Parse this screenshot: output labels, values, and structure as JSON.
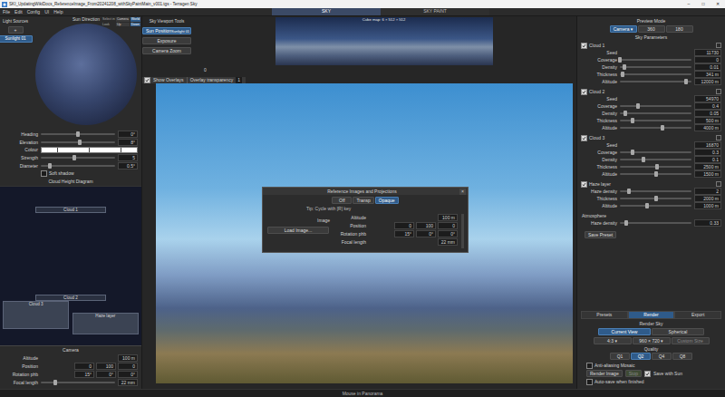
{
  "window": {
    "title": "SKI_UpdatingWikiDocs_ReferenceImage_From20241208_withSkyPaintMain_v001.tgs - Terragen Sky",
    "controls": [
      "–",
      "□",
      "✕"
    ]
  },
  "menu": [
    "File",
    "Edit",
    "Config",
    "UI",
    "Help"
  ],
  "mode_tabs": [
    {
      "label": "SKY",
      "selected": true
    },
    {
      "label": "SKY PAINT",
      "selected": false
    }
  ],
  "light_sources": {
    "title": "Light Sources",
    "add": "+",
    "items": [
      {
        "label": "Sunlight 01",
        "selected": true
      }
    ]
  },
  "sun_direction": {
    "title": "Sun Direction",
    "select_in": {
      "label": "Select in",
      "options": [
        {
          "label": "Camera",
          "selected": false
        },
        {
          "label": "World",
          "selected": true
        }
      ]
    },
    "look": {
      "label": "Look",
      "options": [
        {
          "label": "Up",
          "selected": false
        },
        {
          "label": "Down",
          "selected": true
        }
      ]
    }
  },
  "sun_params": [
    {
      "kind": "slider",
      "label": "Heading",
      "value": "0°",
      "level": 0.5
    },
    {
      "kind": "slider",
      "label": "Elevation",
      "value": "8°",
      "level": 0.52
    },
    {
      "kind": "colour",
      "label": "Colour",
      "swatch": "#ffffff"
    },
    {
      "kind": "slider",
      "label": "Strength",
      "value": "5",
      "level": 0.45
    },
    {
      "kind": "slider",
      "label": "Diameter",
      "value": "0.5°",
      "level": 0.12
    },
    {
      "kind": "check",
      "label": "Soft shadow",
      "checked": false
    }
  ],
  "cloud_diagram": {
    "title": "Cloud Height Diagram",
    "max_m": 14000,
    "layers": [
      {
        "label": "Cloud 1",
        "from_m": 12000,
        "to_m": 12341,
        "lane": "center"
      },
      {
        "label": "Cloud 2",
        "from_m": 4000,
        "to_m": 4500,
        "lane": "center"
      },
      {
        "label": "Cloud 3",
        "from_m": 1500,
        "to_m": 4000,
        "lane": "left"
      },
      {
        "label": "Haze layer",
        "from_m": 1000,
        "to_m": 3000,
        "lane": "right"
      }
    ]
  },
  "camera": {
    "title": "Camera",
    "rows": [
      {
        "kind": "field",
        "label": "Altitude",
        "values": [
          "100 m"
        ]
      },
      {
        "kind": "field",
        "label": "Position",
        "values": [
          "0",
          "100",
          "0"
        ]
      },
      {
        "kind": "field",
        "label": "Rotation phb",
        "values": [
          "15°",
          "0°",
          "0°"
        ]
      },
      {
        "kind": "slider",
        "label": "Focal length",
        "value": "22 mm",
        "level": 0.2
      }
    ]
  },
  "viewport_tools": {
    "title": "Sky Viewport Tools",
    "items": [
      {
        "label": "Sun Position",
        "sub": "Sunlight 01",
        "selected": true
      },
      {
        "label": "Exposure",
        "selected": false
      },
      {
        "label": "Camera Zoom",
        "selected": false
      }
    ]
  },
  "sky_strip": {
    "caption": "Cube map: 6 × 512 × 512",
    "marker": "0"
  },
  "overlays": {
    "checked": true,
    "label": "Show Overlays",
    "transparency_label": "Overlay transparency",
    "transparency": "1"
  },
  "reference_dialog": {
    "title": "Reference Images and Projections",
    "close": "×",
    "display": [
      {
        "label": "Off",
        "selected": false
      },
      {
        "label": "Transp",
        "selected": false
      },
      {
        "label": "Opaque",
        "selected": true
      }
    ],
    "tip": "Tip: Cycle with [R] key",
    "image_label": "Image",
    "load_button": "Load Image...",
    "rows": [
      {
        "kind": "field",
        "label": "Altitude",
        "values": [
          "100 m"
        ]
      },
      {
        "kind": "field",
        "label": "Position",
        "values": [
          "0",
          "100",
          "0"
        ]
      },
      {
        "kind": "field",
        "label": "Rotation phb",
        "values": [
          "15°",
          "0°",
          "0°"
        ]
      },
      {
        "kind": "field",
        "label": "Focal length",
        "values": [
          "22 mm"
        ]
      }
    ]
  },
  "preview_mode": {
    "title": "Preview Mode",
    "options": [
      {
        "label": "Camera ▾",
        "selected": true
      },
      {
        "label": "360",
        "selected": false
      },
      {
        "label": "180",
        "selected": false
      }
    ]
  },
  "sky_parameters": {
    "title": "Sky Parameters",
    "groups": [
      {
        "title": "Cloud 1",
        "checked": true,
        "rows": [
          {
            "kind": "field",
            "label": "Seed",
            "value": "11730"
          },
          {
            "kind": "slider",
            "label": "Coverage",
            "value": "0",
            "level": 0.0
          },
          {
            "kind": "slider",
            "label": "Density",
            "value": "0.01",
            "level": 0.06
          },
          {
            "kind": "slider",
            "label": "Thickness",
            "value": "341 m",
            "level": 0.04
          },
          {
            "kind": "slider",
            "label": "Altitude",
            "value": "12000 m",
            "level": 0.92
          }
        ]
      },
      {
        "title": "Cloud 2",
        "checked": true,
        "rows": [
          {
            "kind": "field",
            "label": "Seed",
            "value": "54970"
          },
          {
            "kind": "slider",
            "label": "Coverage",
            "value": "0.4",
            "level": 0.25
          },
          {
            "kind": "slider",
            "label": "Density",
            "value": "0.05",
            "level": 0.08
          },
          {
            "kind": "slider",
            "label": "Thickness",
            "value": "500 m",
            "level": 0.18
          },
          {
            "kind": "slider",
            "label": "Altitude",
            "value": "4000 m",
            "level": 0.6
          }
        ]
      },
      {
        "title": "Cloud 3",
        "checked": true,
        "rows": [
          {
            "kind": "field",
            "label": "Seed",
            "value": "16870"
          },
          {
            "kind": "slider",
            "label": "Coverage",
            "value": "0.3",
            "level": 0.18
          },
          {
            "kind": "slider",
            "label": "Density",
            "value": "0.1",
            "level": 0.33
          },
          {
            "kind": "slider",
            "label": "Thickness",
            "value": "2500 m",
            "level": 0.52
          },
          {
            "kind": "slider",
            "label": "Altitude",
            "value": "1500 m",
            "level": 0.5
          }
        ]
      },
      {
        "title": "Haze layer",
        "checked": true,
        "rows": [
          {
            "kind": "slider",
            "label": "Haze density",
            "value": "2",
            "level": 0.13
          },
          {
            "kind": "slider",
            "label": "Thickness",
            "value": "2000 m",
            "level": 0.5
          },
          {
            "kind": "slider",
            "label": "Altitude",
            "value": "1000 m",
            "level": 0.38
          }
        ]
      }
    ],
    "atmosphere": {
      "title": "Atmosphere",
      "rows": [
        {
          "kind": "slider",
          "label": "Haze density",
          "value": "0.33",
          "level": 0.09
        }
      ]
    },
    "save_button": "Save Preset"
  },
  "render": {
    "tabs": [
      {
        "label": "Presets",
        "selected": false
      },
      {
        "label": "Render",
        "selected": true
      },
      {
        "label": "Export",
        "selected": false
      }
    ],
    "title": "Render Sky",
    "view": [
      {
        "label": "Current View",
        "selected": true
      },
      {
        "label": "Spherical",
        "selected": false
      }
    ],
    "size": [
      {
        "label": "4:3 ▾",
        "disabled": false
      },
      {
        "label": "960 × 720 ▾",
        "disabled": false
      },
      {
        "label": "Custom Size",
        "disabled": true
      }
    ],
    "quality_label": "Quality",
    "quality": [
      {
        "label": "Q1",
        "selected": false
      },
      {
        "label": "Q2",
        "selected": true
      },
      {
        "label": "Q4",
        "selected": false
      },
      {
        "label": "Q8",
        "selected": false
      }
    ],
    "anti_alias": {
      "label": "Anti-aliasing Mosaic",
      "checked": false
    },
    "render_button": "Render Image",
    "stop_button": {
      "label": "Stop",
      "disabled": true
    },
    "save_with_sun": {
      "label": "Save with Sun",
      "checked": true
    },
    "auto_save": {
      "label": "Auto-save when finished",
      "checked": false
    }
  },
  "status_bar": "Mouse in Panorama"
}
